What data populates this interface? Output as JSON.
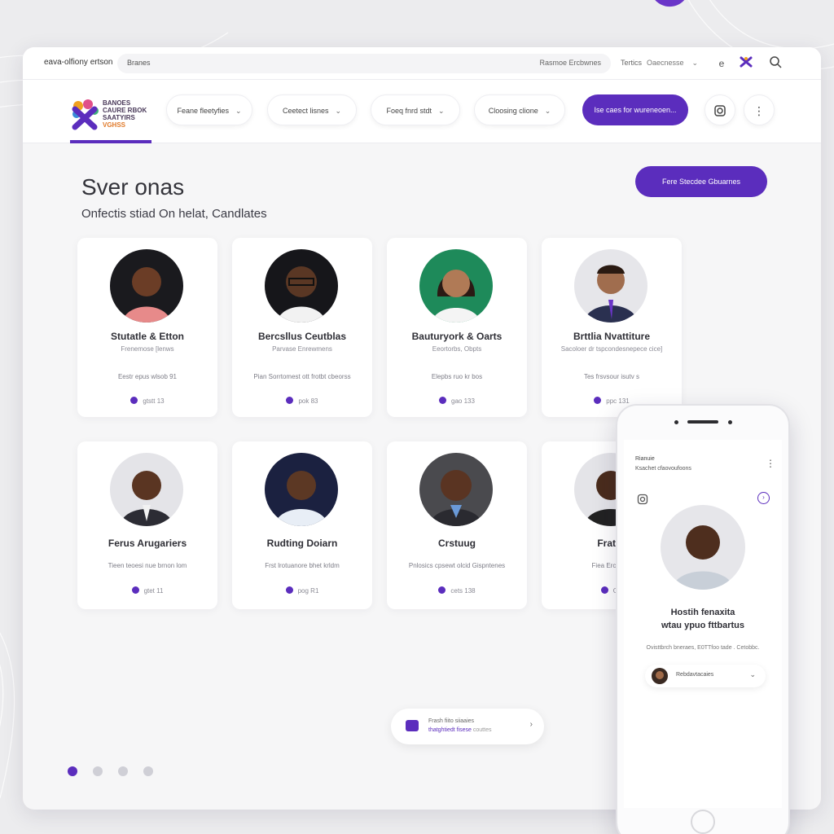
{
  "browser": {
    "title": "eava-olfiony ertson",
    "address_query": "Branes",
    "address_right": "Rasmoe Ercbwnes",
    "favorites": "Tertics",
    "dropdown": "Oaecnesse",
    "icons": [
      "settings-icon",
      "brand-logo-icon",
      "search-icon"
    ]
  },
  "header": {
    "logo_lines": [
      "BANOES",
      "CAURE RBOK",
      "SAATYIRS"
    ],
    "logo_accent": "VGHSS",
    "filters": [
      {
        "label": "Feane fleetyfies"
      },
      {
        "label": "Ceetect lisnes"
      },
      {
        "label": "Foeq fnrd stdt"
      },
      {
        "label": "Cloosing clione"
      }
    ],
    "cta": "Ise caes for wureneoen...",
    "icons": [
      "instagram-icon",
      "more-vertical-icon"
    ]
  },
  "main": {
    "title": "Sver onas",
    "subtitle": "Onfectis stiad On helat, Candlates",
    "cta": "Fere Stecdee Gbuarnes"
  },
  "candidates": [
    {
      "name": "Stutatle & Etton",
      "role": "Frenemose [lenws",
      "desc": "Eestr epus wlsob 91",
      "meta": "gtstt 13"
    },
    {
      "name": "Bercsllus Ceutblas",
      "role": "Parvase Enrewmens",
      "desc": "Pian Sorrtomest ott frotbt cbeorss",
      "meta": "pok 83"
    },
    {
      "name": "Bauturyork & Oarts",
      "role": "Eeortorbs, Obpts",
      "desc": "Elepbs ruo kr bos",
      "meta": "gao 133"
    },
    {
      "name": "Brttlia Nvattiture",
      "role": "Sacoloer dr tspcondesnepece cice]",
      "desc": "Tes frsvsour isutv s",
      "meta": "ppc 131"
    },
    {
      "name": "Ferus Arugariers",
      "role": "",
      "desc": "Tieen teoesi nue brnon lom",
      "meta": "gtet 11"
    },
    {
      "name": "Rudting Doiarn",
      "role": "",
      "desc": "Frst lrotuanore bhet krldm",
      "meta": "pog R1"
    },
    {
      "name": "Crstuug",
      "role": "",
      "desc": "Pnlosics cpsewt olcid Gispntenes",
      "meta": "cets 138"
    },
    {
      "name": "Frat G",
      "role": "",
      "desc": "Fiea Ercuotioi",
      "meta": "GB"
    }
  ],
  "toast": {
    "line1": "Frash fiito siiaaies",
    "line2": "thatghtiedt fisese",
    "line2_muted": "couttes"
  },
  "pagination": {
    "count": 4,
    "active": 0
  },
  "phone": {
    "title": "Rianuie",
    "subtitle": "Ksachet cfaovoufoons",
    "name_line1": "Hostih fenaxita",
    "name_line2": "wtau ypuo fttbartus",
    "meta": "Ovisttbrch bneraes,   E0TTfoo tade .  Cetobbc.",
    "select_label": "Rebdavtacaies"
  },
  "colors": {
    "accent": "#5b2dbd",
    "background": "#ececee",
    "surface": "#ffffff"
  }
}
